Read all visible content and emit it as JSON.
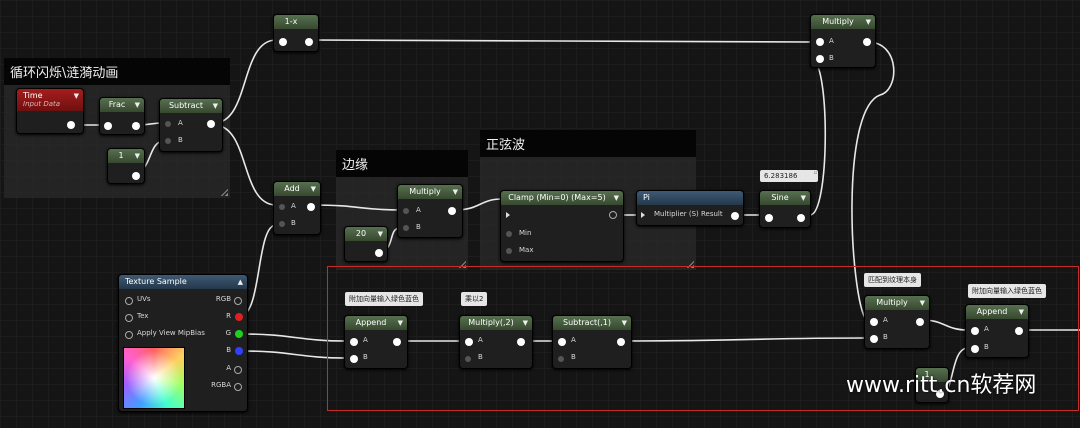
{
  "comments": {
    "loop": "循环闪烁\\涟漪动画",
    "edge": "边缘",
    "sine_wave": "正弦波"
  },
  "nodes": {
    "time": {
      "title": "Time",
      "subtitle": "Input Data"
    },
    "frac": {
      "title": "Frac"
    },
    "subtract_top": {
      "title": "Subtract",
      "pin_a": "A",
      "pin_b": "B"
    },
    "const_1": {
      "value": "1"
    },
    "one_minus": {
      "title": "1-x"
    },
    "multiply_top": {
      "title": "Multiply",
      "pin_a": "A",
      "pin_b": "B"
    },
    "add": {
      "title": "Add",
      "pin_a": "A",
      "pin_b": "B"
    },
    "multiply_edge": {
      "title": "Multiply",
      "pin_a": "A",
      "pin_b": "B"
    },
    "const_20": {
      "value": "20"
    },
    "clamp": {
      "title": "Clamp (Min=0) (Max=5)",
      "pin_min": "Min",
      "pin_max": "Max"
    },
    "pi": {
      "title": "Pi",
      "pin_label": "Multiplier (S) Result"
    },
    "sine": {
      "title": "Sine",
      "bubble": "6.283186"
    },
    "texture_sample": {
      "title": "Texture Sample",
      "inputs": [
        "UVs",
        "Tex",
        "Apply View MipBias"
      ],
      "outputs": [
        "RGB",
        "R",
        "G",
        "B",
        "A",
        "RGBA"
      ]
    },
    "append_1": {
      "title": "Append",
      "pin_a": "A",
      "pin_b": "B",
      "bubble": "附加向量输入绿色蓝色"
    },
    "multiply_2": {
      "title": "Multiply(,2)",
      "pin_a": "A",
      "pin_b": "B",
      "bubble": "乘以2"
    },
    "subtract_1": {
      "title": "Subtract(,1)",
      "pin_a": "A",
      "pin_b": "B"
    },
    "multiply_match": {
      "title": "Multiply",
      "pin_a": "A",
      "pin_b": "B",
      "bubble": "匹配到纹理本身"
    },
    "append_2": {
      "title": "Append",
      "pin_a": "A",
      "pin_b": "B",
      "bubble": "附加向量输入绿色蓝色"
    },
    "const_small": {
      "value": "1"
    }
  },
  "watermark": "www.ritt.cn软荐网",
  "colors": {
    "highlight_box": "#c92a2a",
    "node_header": "#4a6343",
    "time_header": "#8b1515",
    "pi_header": "#34506a"
  }
}
